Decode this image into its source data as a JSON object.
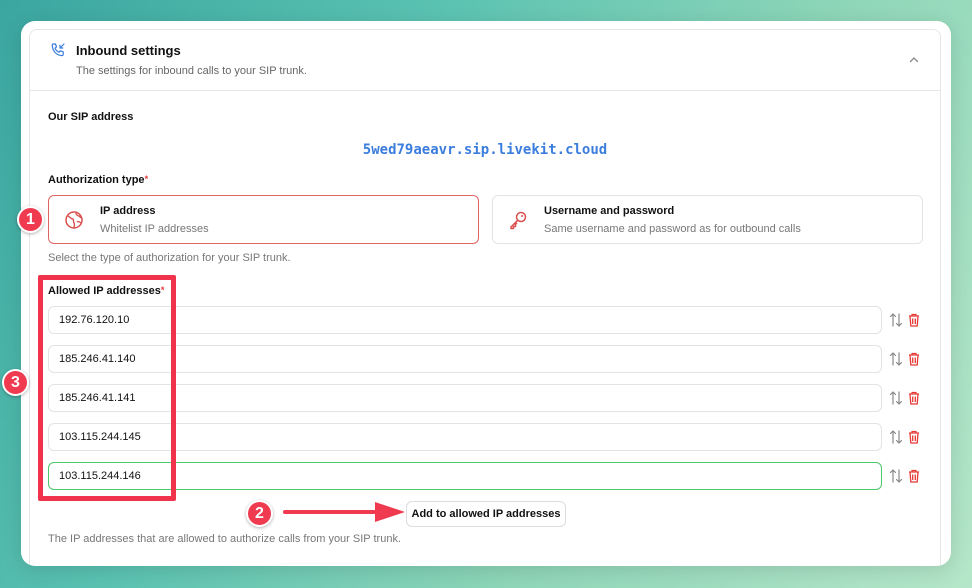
{
  "header": {
    "title": "Inbound settings",
    "subtitle": "The settings for inbound calls to your SIP trunk.",
    "icon": "phone-incoming-icon"
  },
  "sip": {
    "label": "Our SIP address",
    "address": "5wed79aeavr.sip.livekit.cloud"
  },
  "auth": {
    "label": "Authorization type",
    "required_mark": "*",
    "help": "Select the type of authorization for your SIP trunk.",
    "options": [
      {
        "title": "IP address",
        "desc": "Whitelist IP addresses",
        "icon": "globe-icon",
        "selected": true
      },
      {
        "title": "Username and password",
        "desc": "Same username and password as for outbound calls",
        "icon": "key-icon",
        "selected": false
      }
    ]
  },
  "allowed": {
    "label": "Allowed IP addresses",
    "required_mark": "*",
    "ips": [
      "192.76.120.10",
      "185.246.41.140",
      "185.246.41.141",
      "103.115.244.145",
      "103.115.244.146"
    ],
    "add_label": "Add to allowed IP addresses",
    "help": "The IP addresses that are allowed to authorize calls from your SIP trunk."
  },
  "annotations": {
    "badge1": "1",
    "badge2": "2",
    "badge3": "3"
  },
  "colors": {
    "accent_blue": "#3b7ddd",
    "highlight_red": "#f0334a",
    "active_green": "#4cc76a",
    "trash_red": "#e53935"
  }
}
